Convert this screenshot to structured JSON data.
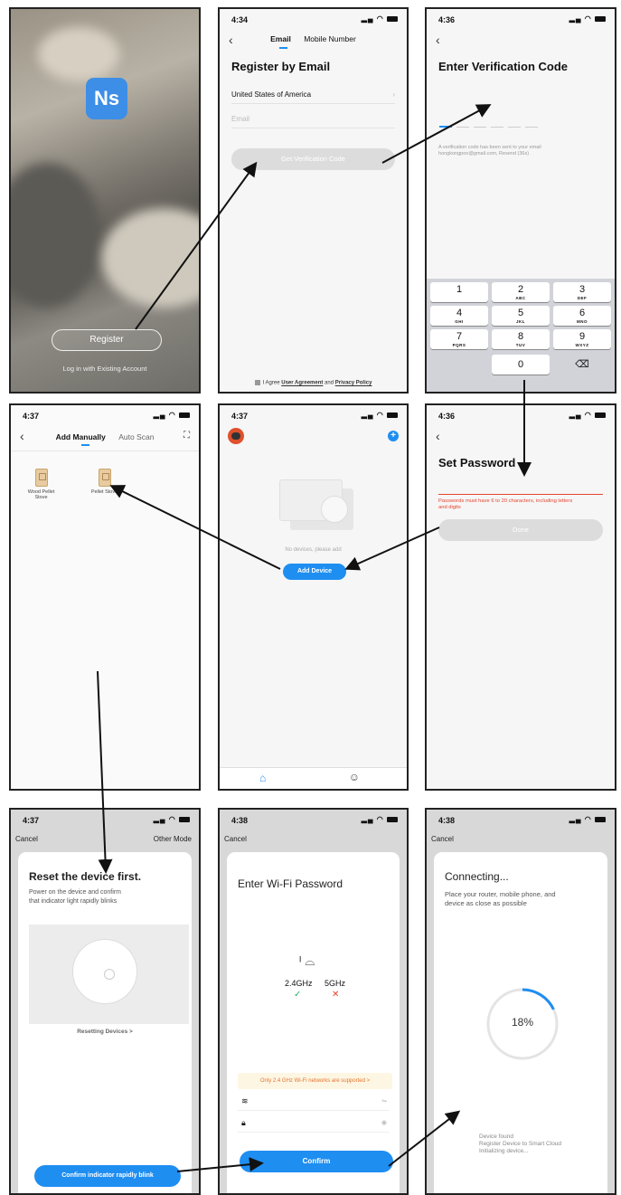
{
  "screens": {
    "s1": {
      "logo": "Ns",
      "register_btn": "Register",
      "login_link": "Log in with Existing Account"
    },
    "s2": {
      "time": "4:34",
      "tab_email": "Email",
      "tab_mobile": "Mobile Number",
      "title": "Register by Email",
      "country": "United States of America",
      "email_placeholder": "Email",
      "get_code_btn": "Get Verification Code",
      "agree_prefix": "I Agree",
      "agree_user": "User Agreement",
      "agree_and": "and",
      "agree_privacy": "Privacy Policy"
    },
    "s3": {
      "time": "4:36",
      "title": "Enter Verification Code",
      "note_line1": "A verification code has been sent to your email",
      "note_line2": "hongkongpoo@gmail.com, Resend (36s)",
      "keys": [
        {
          "n": "1",
          "l": ""
        },
        {
          "n": "2",
          "l": "ABC"
        },
        {
          "n": "3",
          "l": "DEF"
        },
        {
          "n": "4",
          "l": "GHI"
        },
        {
          "n": "5",
          "l": "JKL"
        },
        {
          "n": "6",
          "l": "MNO"
        },
        {
          "n": "7",
          "l": "PQRS"
        },
        {
          "n": "8",
          "l": "TUV"
        },
        {
          "n": "9",
          "l": "WXYZ"
        },
        {
          "n": "0",
          "l": ""
        }
      ],
      "delete_key": "⌫"
    },
    "s4": {
      "time": "4:37",
      "tab_manual": "Add Manually",
      "tab_auto": "Auto Scan",
      "device1_line1": "Wood Pellet",
      "device1_line2": "Stove",
      "device2": "Pellet Stove"
    },
    "s5": {
      "time": "4:37",
      "empty_text": "No devices, please add",
      "add_btn": "Add Device"
    },
    "s6": {
      "time": "4:36",
      "title": "Set Password",
      "error_line1": "Passwords must have 6 to 20 characters, including letters",
      "error_line2": "and digits",
      "done_btn": "Done"
    },
    "s7": {
      "time": "4:37",
      "cancel": "Cancel",
      "other_mode": "Other Mode",
      "title": "Reset the device first.",
      "text_line1": "Power on the device and confirm",
      "text_line2": "that indicator light rapidly blinks",
      "resetting_link": "Resetting Devices >",
      "confirm_btn": "Confirm indicator rapidly blink"
    },
    "s8": {
      "time": "4:38",
      "cancel": "Cancel",
      "title": "Enter Wi-Fi Password",
      "band_24": "2.4GHz",
      "band_5": "5GHz",
      "warning": "Only 2.4 GHz Wi-Fi networks are supported >",
      "confirm_btn": "Confirm"
    },
    "s9": {
      "time": "4:38",
      "cancel": "Cancel",
      "title": "Connecting...",
      "text_line1": "Place your router, mobile phone, and",
      "text_line2": "device as close as possible",
      "progress_label": "18%",
      "progress": 0.18,
      "step1": "Device found",
      "step2": "Register Device to Smart Cloud",
      "step3": "Initializing device..."
    }
  },
  "colors": {
    "accent": "#1f8ef1",
    "error": "#e5452f",
    "warning_bg": "#fdf6e3"
  }
}
